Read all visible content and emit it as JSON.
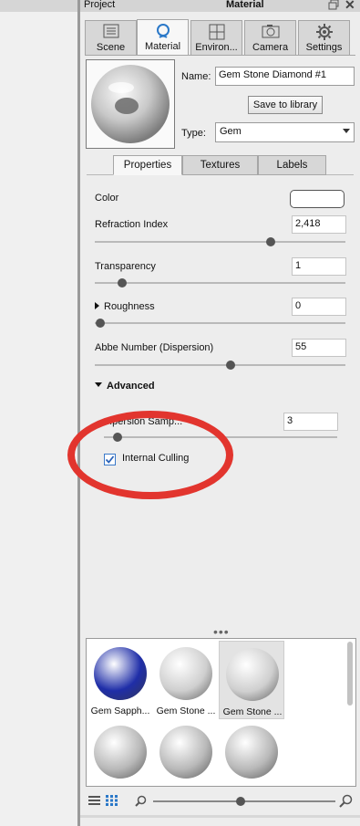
{
  "left_panel": {},
  "title_bar": {
    "left_label": "Project",
    "title": "Material"
  },
  "main_tabs": [
    {
      "label": "Scene",
      "icon": "scene-icon"
    },
    {
      "label": "Material",
      "icon": "material-icon",
      "active": true
    },
    {
      "label": "Environ...",
      "icon": "environment-icon"
    },
    {
      "label": "Camera",
      "icon": "camera-icon"
    },
    {
      "label": "Settings",
      "icon": "settings-icon"
    }
  ],
  "material": {
    "name_label": "Name:",
    "name_value": "Gem Stone Diamond #1",
    "save_label": "Save to library",
    "type_label": "Type:",
    "type_value": "Gem"
  },
  "sub_tabs": [
    {
      "label": "Properties",
      "active": true
    },
    {
      "label": "Textures"
    },
    {
      "label": "Labels"
    }
  ],
  "properties": {
    "color_label": "Color",
    "color_value": "#ffffff",
    "refraction_label": "Refraction Index",
    "refraction_value": "2,418",
    "refraction_slider": 0.7,
    "transparency_label": "Transparency",
    "transparency_value": "1",
    "transparency_slider": 0.11,
    "roughness_label": "Roughness",
    "roughness_value": "0",
    "roughness_slider": 0.02,
    "abbe_label": "Abbe Number (Dispersion)",
    "abbe_value": "55",
    "abbe_slider": 0.54
  },
  "advanced": {
    "label": "Advanced",
    "dispersion_label": "...persion Samp...",
    "dispersion_value": "3",
    "dispersion_slider": 0.06,
    "culling_label": "Internal Culling",
    "culling_checked": true
  },
  "annotation": {
    "color": "#e2352e"
  },
  "library": {
    "items": [
      {
        "label": "Gem Sapph...",
        "color": "#1f2ea8"
      },
      {
        "label": "Gem Stone ...",
        "color": "#cfcfcf"
      },
      {
        "label": "Gem Stone ...",
        "color": "#cfcfcf",
        "selected": true
      },
      {
        "label": "",
        "color": "#b9b9b9"
      },
      {
        "label": "",
        "color": "#b9b9b9"
      },
      {
        "label": "",
        "color": "#b9b9b9"
      }
    ]
  },
  "bottom": {
    "zoom_level": 0.48
  }
}
